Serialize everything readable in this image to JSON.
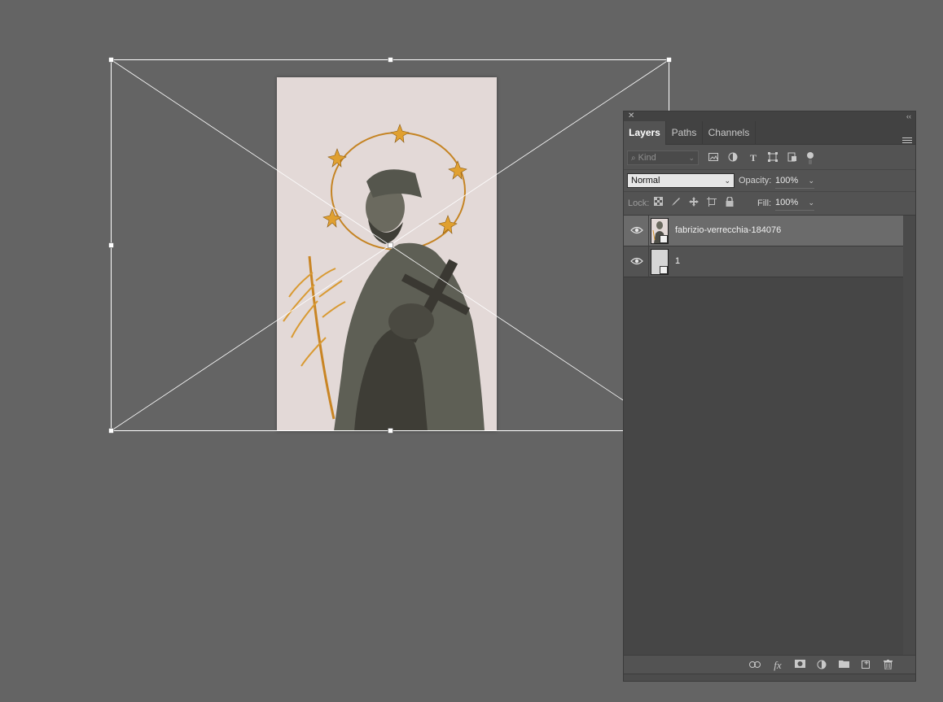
{
  "app": {
    "transform": "free-transform-placeholder"
  },
  "document": {
    "image_subject": "statue-with-golden-halo-and-palm",
    "background_color": "#e3d9d7",
    "accent_gold": "#e0a030"
  },
  "layers_panel": {
    "tabs": [
      {
        "label": "Layers",
        "active": true
      },
      {
        "label": "Paths",
        "active": false
      },
      {
        "label": "Channels",
        "active": false
      }
    ],
    "filter": {
      "kind_placeholder": "Kind",
      "icons": [
        "image-filter-icon",
        "adjustment-filter-icon",
        "type-filter-icon",
        "shape-filter-icon",
        "smart-object-filter-icon",
        "filter-toggle-icon"
      ]
    },
    "blend_mode": "Normal",
    "opacity_label": "Opacity:",
    "opacity_value": "100%",
    "lock_label": "Lock:",
    "fill_label": "Fill:",
    "fill_value": "100%",
    "layers": [
      {
        "name": "fabrizio-verrecchia-184076",
        "visible": true,
        "selected": true,
        "type": "smart-object"
      },
      {
        "name": "1",
        "visible": true,
        "selected": false,
        "type": "smart-object"
      }
    ],
    "bottom_icons": [
      "link-layers-icon",
      "fx-icon",
      "mask-icon",
      "adjustment-icon",
      "group-folder-icon",
      "new-layer-icon",
      "trash-icon"
    ]
  }
}
